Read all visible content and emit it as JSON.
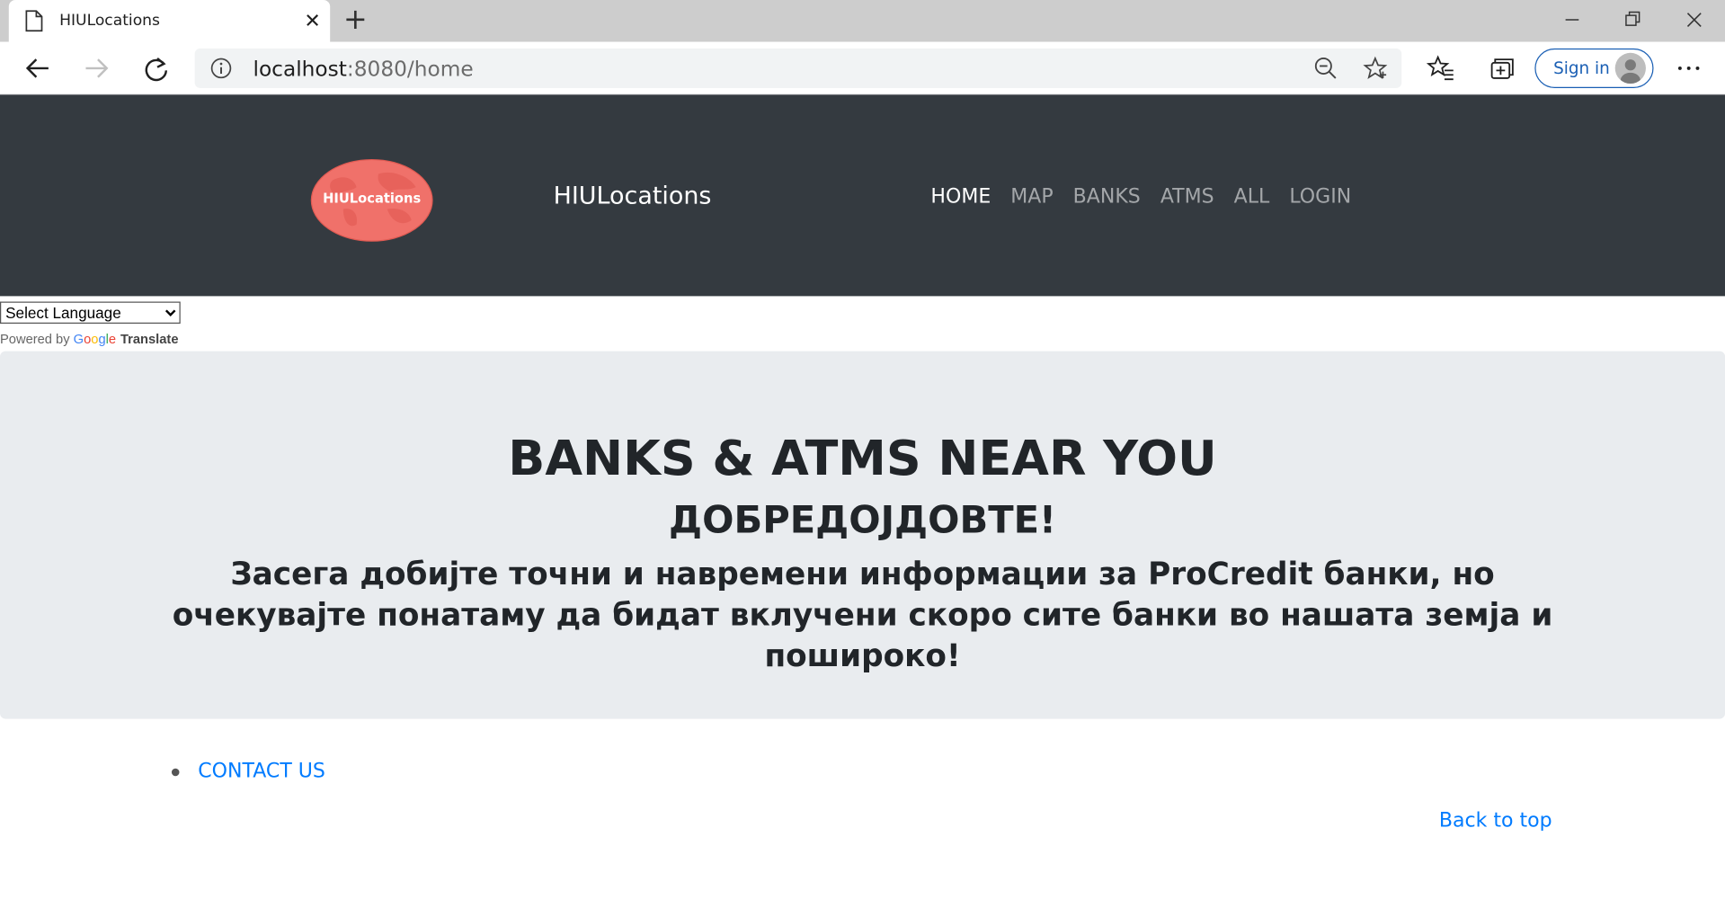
{
  "browser": {
    "tab_title": "HIULocations",
    "url_host": "localhost",
    "url_rest": ":8080/home",
    "signin_label": "Sign in"
  },
  "site": {
    "logo_text": "HIULocations",
    "brand": "HIULocations",
    "nav": [
      {
        "label": "HOME",
        "active": true
      },
      {
        "label": "MAP",
        "active": false
      },
      {
        "label": "BANKS",
        "active": false
      },
      {
        "label": "ATMS",
        "active": false
      },
      {
        "label": "ALL",
        "active": false
      },
      {
        "label": "LOGIN",
        "active": false
      }
    ]
  },
  "translate": {
    "select_value": "Select Language",
    "powered_by": "Powered by",
    "google": [
      "G",
      "o",
      "o",
      "g",
      "l",
      "e"
    ],
    "translate_label": "Translate"
  },
  "hero": {
    "title": "BANKS & ATMS NEAR YOU",
    "subtitle": "ДОБРЕДОЈДОВТЕ!",
    "text": "Засега добијте точни и навремени информации за ProCredit банки, но очекувајте понатаму да бидат вклучени скоро сите банки во нашата земја и пошироко!"
  },
  "footer": {
    "contact_label": "CONTACT US",
    "back_to_top": "Back to top"
  },
  "colors": {
    "header_bg": "#343a40",
    "jumbotron_bg": "#e9ecef",
    "link": "#007bff",
    "logo_red": "#f0716a"
  },
  "icons": [
    "page-icon",
    "close-icon",
    "plus-icon",
    "minimize-icon",
    "restore-icon",
    "window-close-icon",
    "back-arrow-icon",
    "forward-arrow-icon",
    "refresh-icon",
    "info-icon",
    "zoom-out-icon",
    "star-icon",
    "favorites-icon",
    "collections-icon",
    "avatar-icon",
    "more-icon",
    "globe-icon"
  ]
}
